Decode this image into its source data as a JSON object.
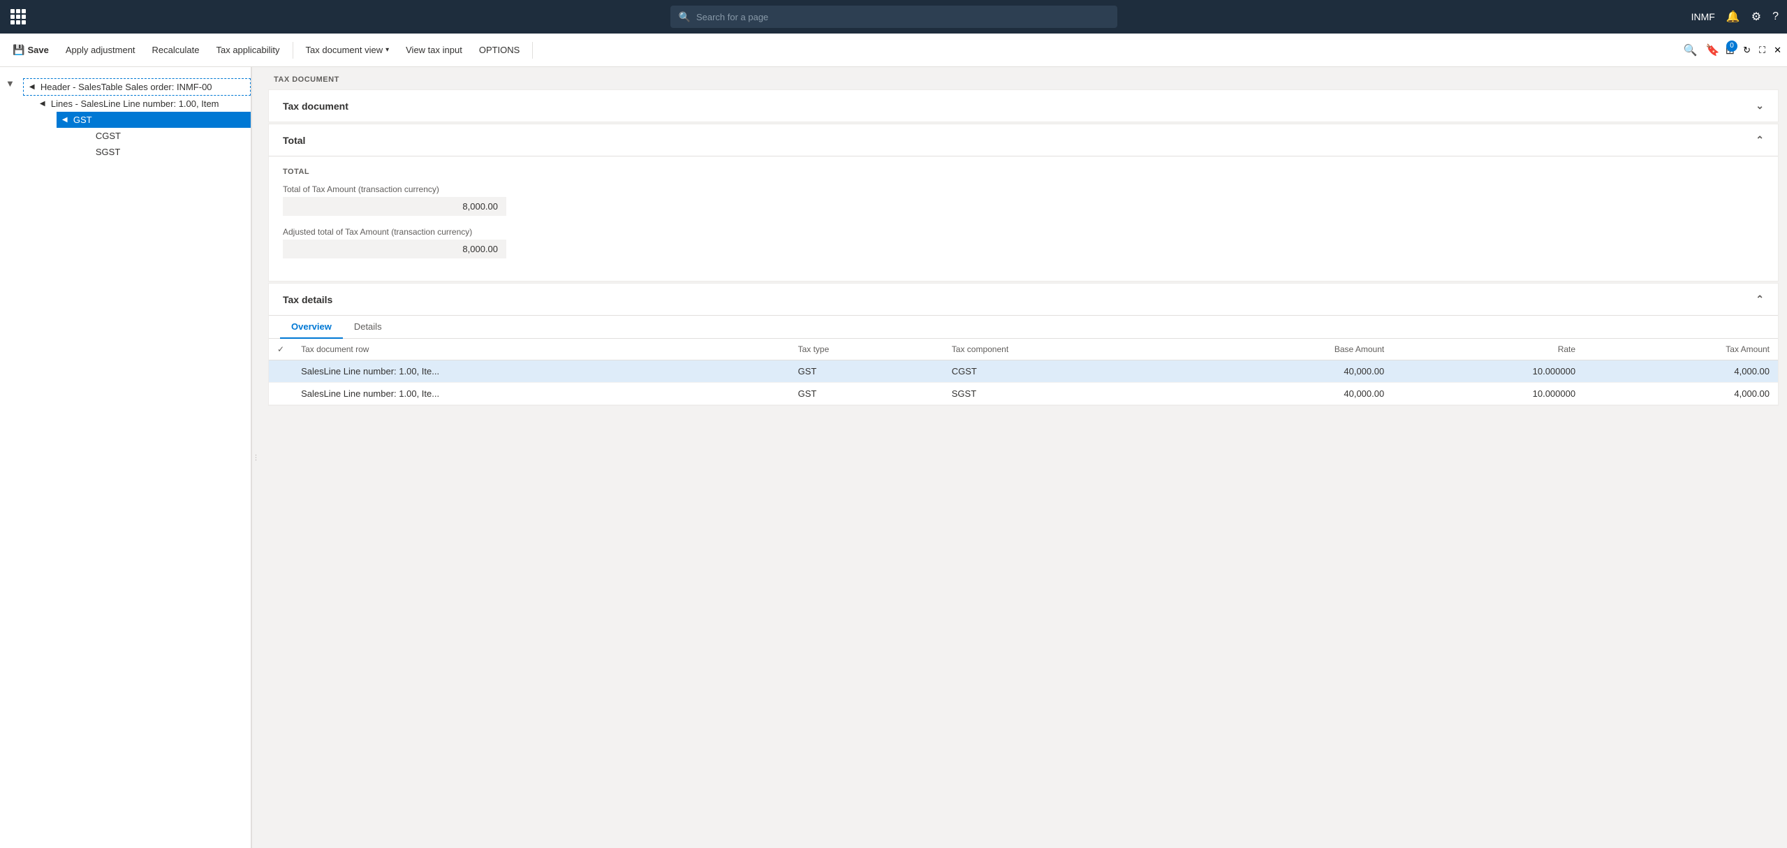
{
  "topnav": {
    "search_placeholder": "Search for a page",
    "user": "INMF",
    "notification_icon": "bell-icon",
    "settings_icon": "gear-icon",
    "help_icon": "help-icon"
  },
  "commandbar": {
    "save_label": "Save",
    "apply_adjustment_label": "Apply adjustment",
    "recalculate_label": "Recalculate",
    "tax_applicability_label": "Tax applicability",
    "tax_document_view_label": "Tax document view",
    "view_tax_input_label": "View tax input",
    "options_label": "OPTIONS"
  },
  "tree": {
    "header_item": "Header - SalesTable Sales order: INMF-00",
    "line_item": "Lines - SalesLine Line number: 1.00, Item",
    "gst_label": "GST",
    "cgst_label": "CGST",
    "sgst_label": "SGST"
  },
  "content": {
    "section_title": "TAX DOCUMENT",
    "tax_document_section": "Tax document",
    "total_section": "Total",
    "tax_details_section": "Tax details",
    "total_label": "TOTAL",
    "total_tax_label": "Total of Tax Amount (transaction currency)",
    "total_tax_value": "8,000.00",
    "adjusted_total_label": "Adjusted total of Tax Amount (transaction currency)",
    "adjusted_total_value": "8,000.00",
    "tab_overview": "Overview",
    "tab_details": "Details",
    "table": {
      "col_check": "",
      "col_tax_document_row": "Tax document row",
      "col_tax_type": "Tax type",
      "col_tax_component": "Tax component",
      "col_base_amount": "Base Amount",
      "col_rate": "Rate",
      "col_tax_amount": "Tax Amount",
      "rows": [
        {
          "tax_document_row": "SalesLine Line number: 1.00, Ite...",
          "tax_type": "GST",
          "tax_component": "CGST",
          "base_amount": "40,000.00",
          "rate": "10.000000",
          "tax_amount": "4,000.00",
          "selected": true
        },
        {
          "tax_document_row": "SalesLine Line number: 1.00, Ite...",
          "tax_type": "GST",
          "tax_component": "SGST",
          "base_amount": "40,000.00",
          "rate": "10.000000",
          "tax_amount": "4,000.00",
          "selected": false
        }
      ]
    }
  }
}
